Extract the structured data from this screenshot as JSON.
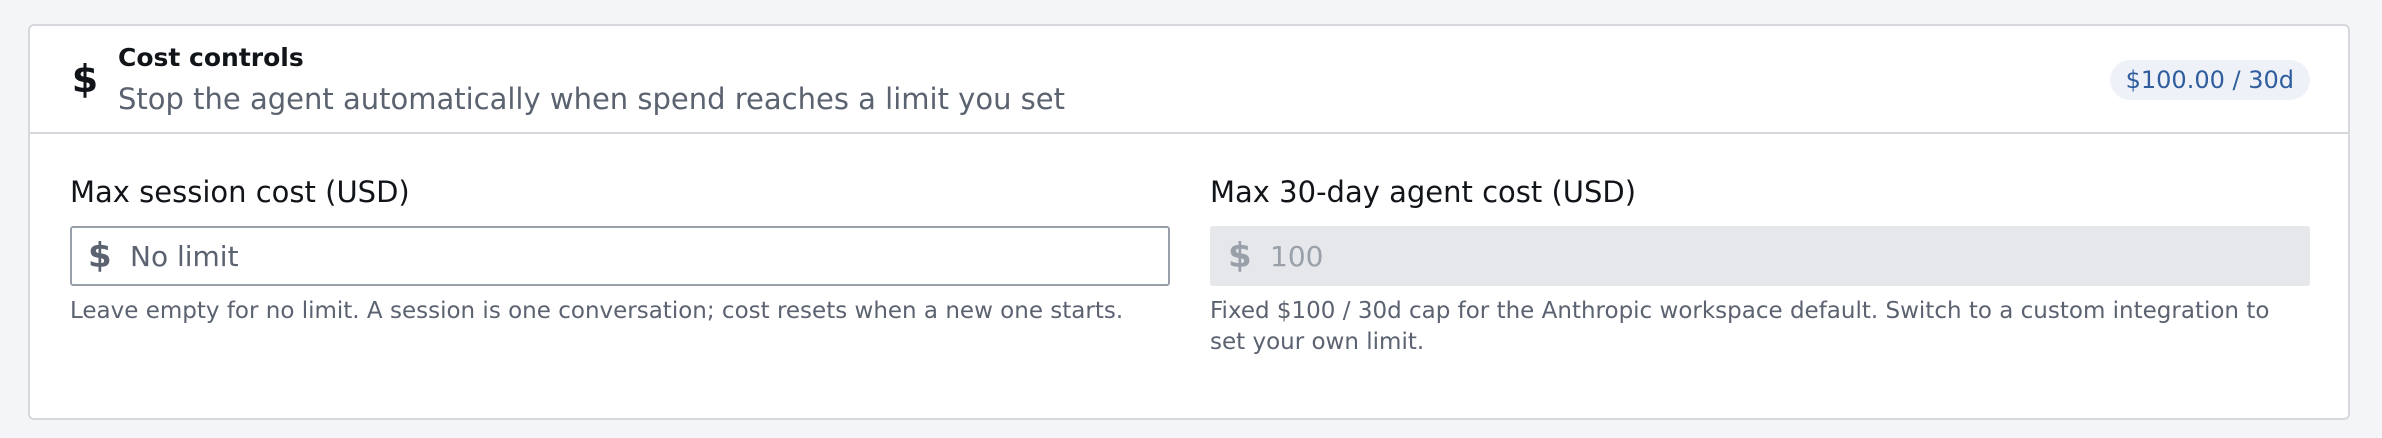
{
  "section": {
    "icon": "dollar-icon",
    "icon_glyph": "$",
    "title": "Cost controls",
    "subtitle": "Stop the agent automatically when spend reaches a limit you set",
    "badge": "$100.00 / 30d"
  },
  "session_cost": {
    "label": "Max session cost (USD)",
    "prefix": "$",
    "value": "",
    "placeholder": "No limit",
    "help": "Leave empty for no limit. A session is one conversation; cost resets when a new one starts."
  },
  "agent_cost": {
    "label": "Max 30-day agent cost (USD)",
    "prefix": "$",
    "value": "",
    "placeholder": "100",
    "disabled": true,
    "help": "Fixed $100 / 30d cap for the Anthropic workspace default. Switch to a custom integration to set your own limit."
  }
}
